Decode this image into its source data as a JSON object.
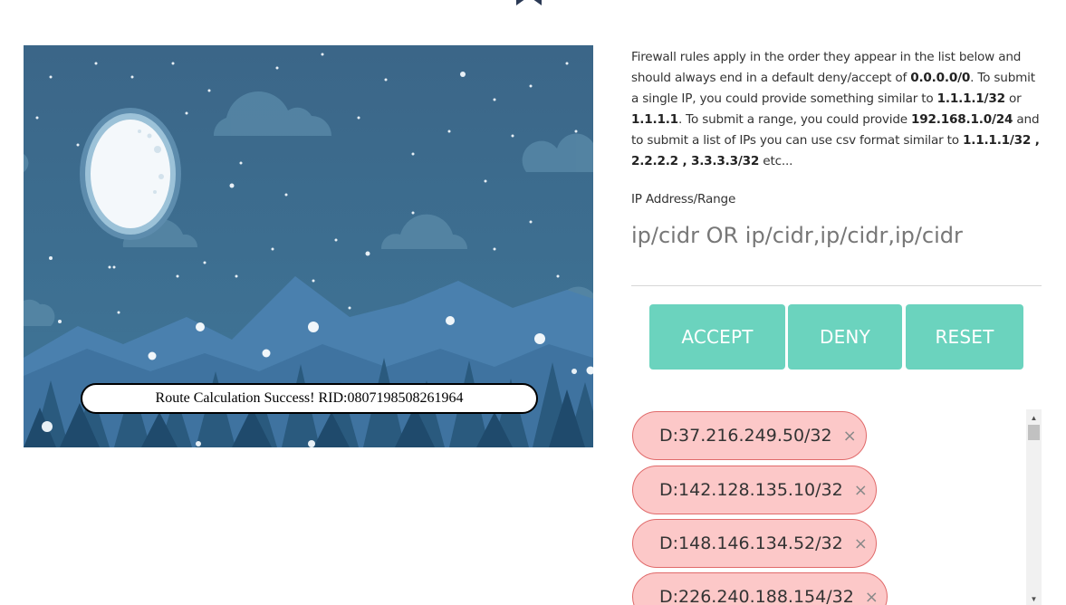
{
  "icons": {
    "top": "bookmark-icon"
  },
  "scene": {
    "status_message": "Route Calculation Success! RID:0807198508261964"
  },
  "info": {
    "p1": "Firewall rules apply in the order they appear in the list below and should always end in a default deny/accept of ",
    "b1": "0.0.0.0/0",
    "p2": ". To submit a single IP, you could provide something similar to ",
    "b2": "1.1.1.1/32",
    "p3": " or ",
    "b3": "1.1.1.1",
    "p4": ". To submit a range, you could provide ",
    "b4": "192.168.1.0/24",
    "p5": " and to submit a list of IPs you can use csv format similar to ",
    "b5": "1.1.1.1/32 , 2.2.2.2 , 3.3.3.3/32",
    "p6": " etc..."
  },
  "form": {
    "label": "IP Address/Range",
    "placeholder": "ip/cidr OR ip/cidr,ip/cidr,ip/cidr",
    "value": ""
  },
  "buttons": {
    "accept": "ACCEPT",
    "deny": "DENY",
    "reset": "RESET"
  },
  "rules": [
    {
      "text": "D:37.216.249.50/32",
      "remove": "×"
    },
    {
      "text": "D:142.128.135.10/32",
      "remove": "×"
    },
    {
      "text": "D:148.146.134.52/32",
      "remove": "×"
    },
    {
      "text": "D:226.240.188.154/32",
      "remove": "×"
    }
  ],
  "colors": {
    "button": "#6bd3be",
    "chip_bg": "#fcc8c8",
    "chip_border": "#e06a6a",
    "scene_sky": "#3a6a8c"
  }
}
